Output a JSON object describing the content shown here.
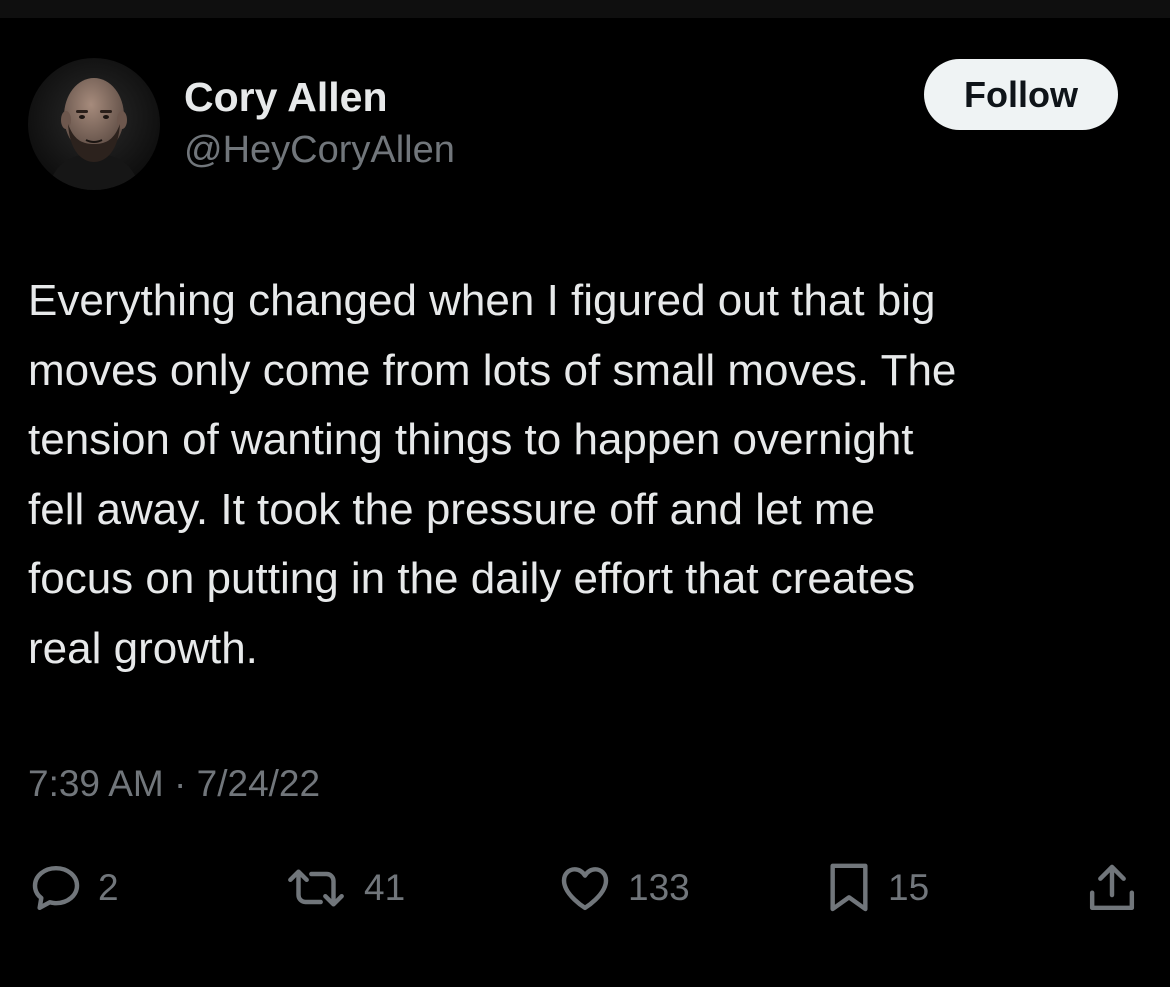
{
  "author": {
    "display_name": "Cory Allen",
    "handle": "@HeyCoryAllen"
  },
  "follow_label": "Follow",
  "tweet": {
    "lines": [
      "Everything changed when I figured out that big",
      "moves only come from lots of small moves. The",
      "tension of wanting things to happen overnight",
      "fell away. It took the pressure off and let me",
      "focus on putting in the daily effort that creates",
      "real growth."
    ],
    "timestamp": "7:39 AM · 7/24/22"
  },
  "actions": {
    "replies": "2",
    "retweets": "41",
    "likes": "133",
    "bookmarks": "15"
  },
  "icons": {
    "reply": "speech-bubble-icon",
    "retweet": "retweet-arrows-icon",
    "like": "heart-icon",
    "bookmark": "bookmark-icon",
    "share": "share-upload-icon"
  },
  "colors": {
    "background": "#000000",
    "primary_text": "#e7e9ea",
    "secondary_text": "#71767b",
    "follow_button_bg": "#eff3f4",
    "follow_button_text": "#0f1419"
  }
}
